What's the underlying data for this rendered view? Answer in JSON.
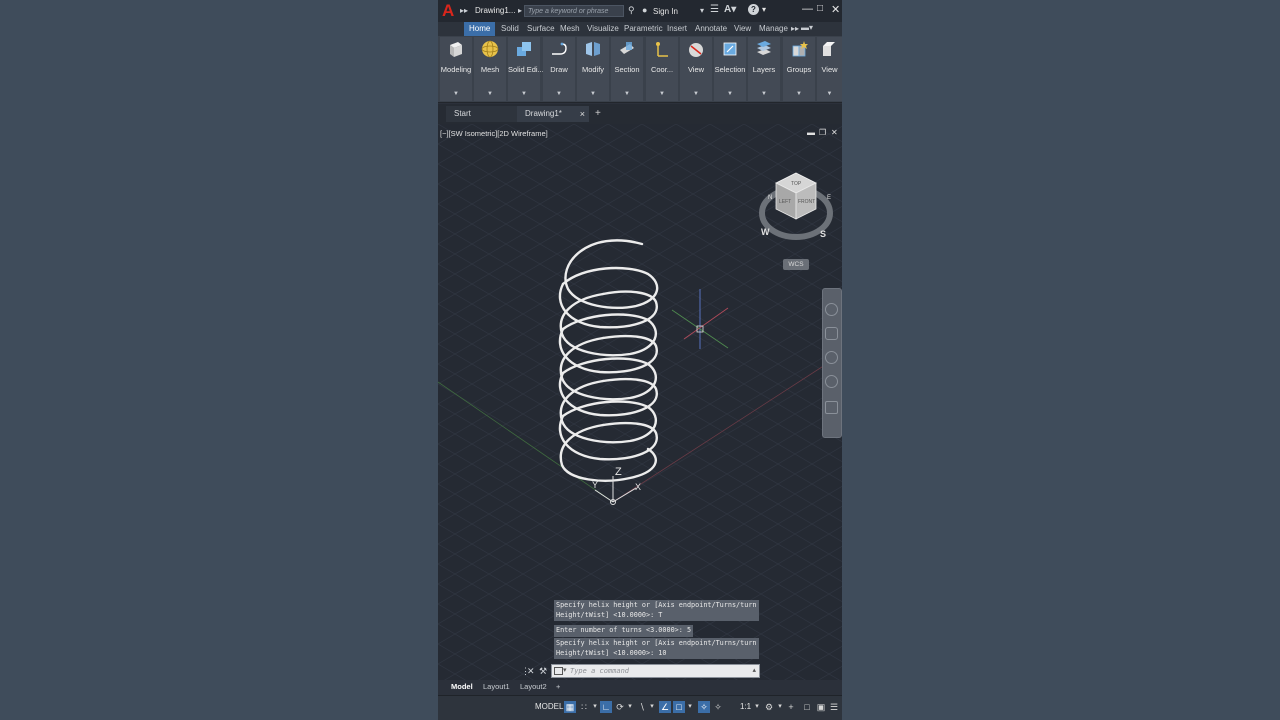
{
  "title_bar": {
    "doc_name": "Drawing1...",
    "search_placeholder": "Type a keyword or phrase",
    "sign_in": "Sign In",
    "qat_arrows": "▸▸",
    "ribbon_more": "▸▸"
  },
  "ribbon_tabs": [
    "Home",
    "Solid",
    "Surface",
    "Mesh",
    "Visualize",
    "Parametric",
    "Insert",
    "Annotate",
    "View",
    "Manage"
  ],
  "ribbon_panels": [
    {
      "label": "Modeling",
      "icon": "box-icon"
    },
    {
      "label": "Mesh",
      "icon": "sphere-icon"
    },
    {
      "label": "Solid Edi...",
      "icon": "solid-edit-icon"
    },
    {
      "label": "Draw",
      "icon": "draw-icon"
    },
    {
      "label": "Modify",
      "icon": "modify-icon"
    },
    {
      "label": "Section",
      "icon": "section-icon"
    },
    {
      "label": "Coor...",
      "icon": "coordinates-icon"
    },
    {
      "label": "View",
      "icon": "view-icon"
    },
    {
      "label": "Selection",
      "icon": "selection-icon"
    },
    {
      "label": "Layers",
      "icon": "layers-icon"
    },
    {
      "label": "Groups",
      "icon": "groups-icon"
    },
    {
      "label": "View",
      "icon": "view2-icon"
    }
  ],
  "file_tabs": {
    "start": "Start",
    "drawing": "Drawing1*",
    "close": "×",
    "add": "+"
  },
  "viewport": {
    "label": "[−][SW Isometric][2D Wireframe]",
    "controls": {
      "minimize": "▬",
      "restore": "❐",
      "close": "✕"
    },
    "viewcube": {
      "top": "TOP",
      "left": "LEFT",
      "front": "FRONT",
      "compass_w": "W",
      "compass_s": "S",
      "compass_n": "N",
      "compass_e": "E"
    },
    "wcs": "WCS",
    "ucs": {
      "z": "Z",
      "y": "Y",
      "x": "X"
    }
  },
  "command_history": [
    "Specify helix height or [Axis endpoint/Turns/turn\nHeight/tWist] <10.0000>: T",
    "Enter number of turns <3.0000>: 5",
    "Specify helix height or [Axis endpoint/Turns/turn\nHeight/tWist] <10.0000>: 10"
  ],
  "command_input_placeholder": "Type a command",
  "layout_tabs": [
    "Model",
    "Layout1",
    "Layout2"
  ],
  "layout_add": "+",
  "status_bar": {
    "model": "MODEL",
    "scale": "1:1"
  },
  "colors": {
    "accent": "#3b6ea8",
    "viewport_bg": "#252a33",
    "helix": "#e8e8e8",
    "logo": "#d9261c"
  }
}
